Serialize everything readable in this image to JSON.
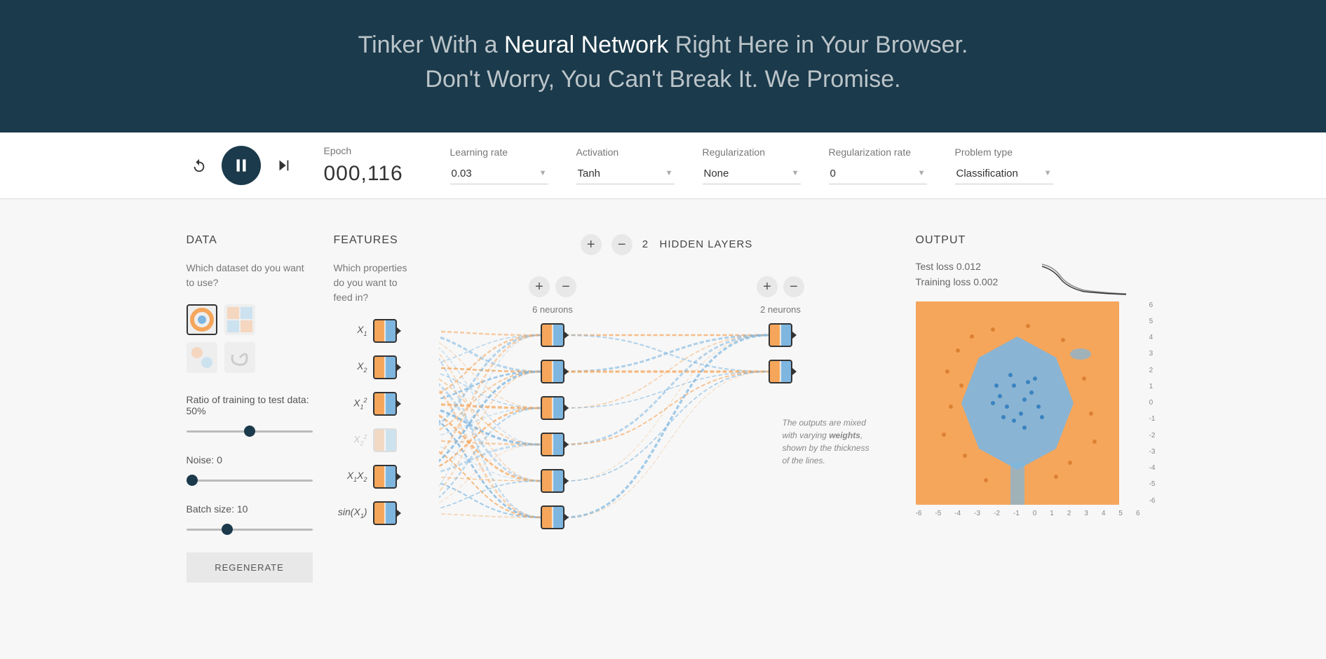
{
  "header": {
    "line1_pre": "Tinker With a ",
    "line1_bold": "Neural Network",
    "line1_post": " Right Here in Your Browser.",
    "line2": "Don't Worry, You Can't Break It. We Promise."
  },
  "controls": {
    "epoch_label": "Epoch",
    "epoch_value": "000,116",
    "learning_rate_label": "Learning rate",
    "learning_rate_value": "0.03",
    "activation_label": "Activation",
    "activation_value": "Tanh",
    "regularization_label": "Regularization",
    "regularization_value": "None",
    "reg_rate_label": "Regularization rate",
    "reg_rate_value": "0",
    "problem_label": "Problem type",
    "problem_value": "Classification"
  },
  "data_panel": {
    "title": "DATA",
    "subtitle": "Which dataset do you want to use?",
    "ratio_label": "Ratio of training to test data:  50%",
    "ratio_value": 50,
    "noise_label": "Noise:  0",
    "noise_value": 0,
    "batch_label": "Batch size:  10",
    "batch_value": 10,
    "regenerate_label": "REGENERATE"
  },
  "features_panel": {
    "title": "FEATURES",
    "subtitle": "Which properties do you want to feed in?",
    "items": [
      {
        "label_html": "X<sub>1</sub>",
        "active": true
      },
      {
        "label_html": "X<sub>2</sub>",
        "active": true
      },
      {
        "label_html": "X<sub>1</sub><sup>2</sup>",
        "active": true
      },
      {
        "label_html": "X<sub>2</sub><sup>2</sup>",
        "active": false
      },
      {
        "label_html": "X<sub>1</sub>X<sub>2</sub>",
        "active": true
      },
      {
        "label_html": "sin(X<sub>1</sub>)",
        "active": true
      }
    ]
  },
  "network": {
    "hidden_count": "2",
    "hidden_label": "HIDDEN LAYERS",
    "layers": [
      {
        "neurons_label": "6 neurons",
        "count": 6
      },
      {
        "neurons_label": "2 neurons",
        "count": 2
      }
    ],
    "tooltip": "The outputs are mixed with varying weights, shown by the thickness of the lines."
  },
  "output": {
    "title": "OUTPUT",
    "test_loss_label": "Test loss",
    "test_loss_value": "0.012",
    "training_loss_label": "Training loss",
    "training_loss_value": "0.002",
    "axis_ticks": [
      "-6",
      "-5",
      "-4",
      "-3",
      "-2",
      "-1",
      "0",
      "1",
      "2",
      "3",
      "4",
      "5",
      "6"
    ]
  },
  "icons": {
    "github": "github-icon",
    "reset": "reset-icon",
    "pause": "pause-icon",
    "step": "step-icon",
    "plus": "plus-icon",
    "minus": "minus-icon",
    "chevron": "chevron-down-icon"
  }
}
